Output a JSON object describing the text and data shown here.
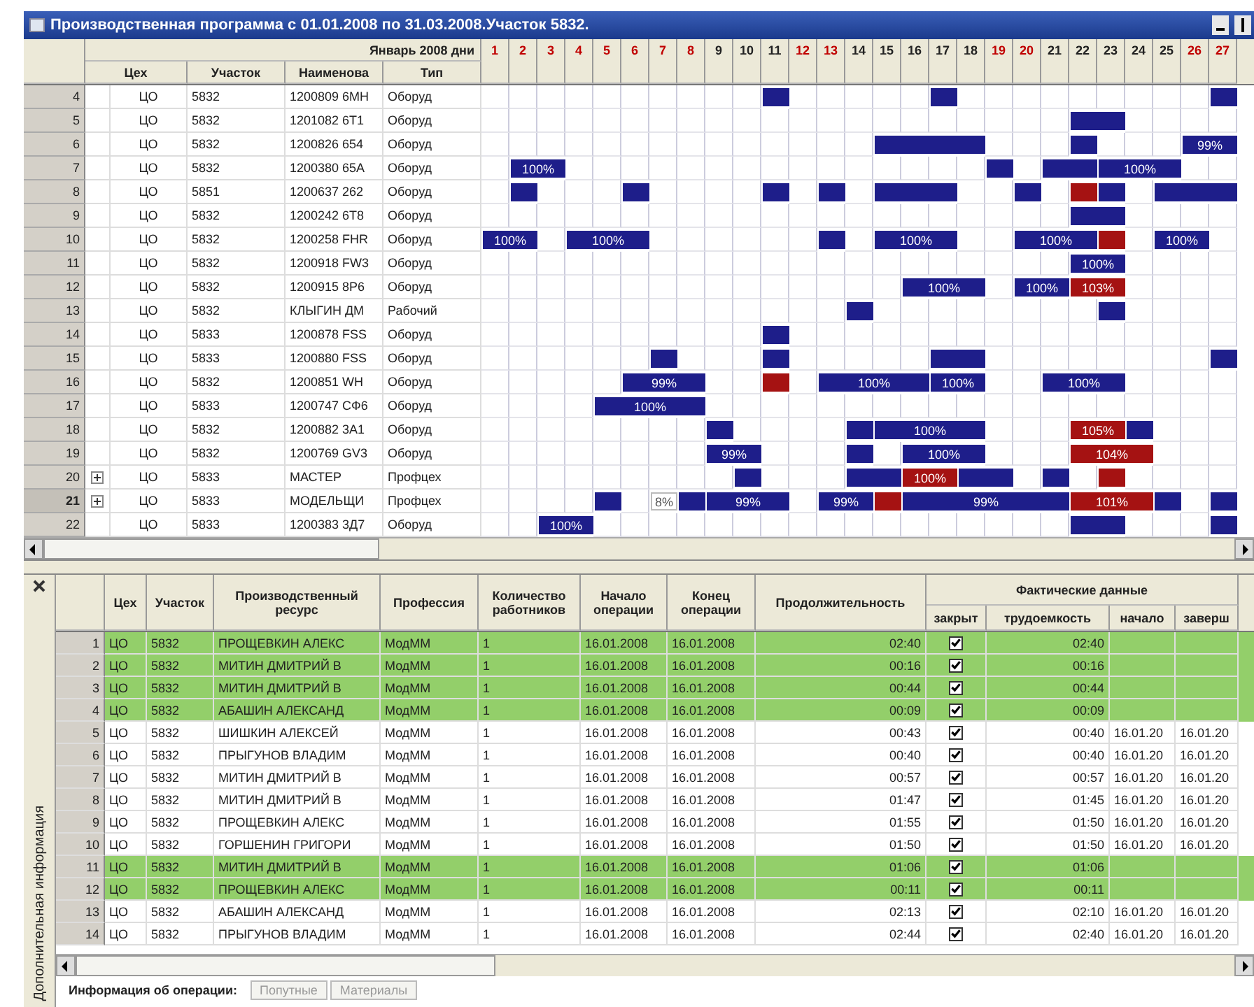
{
  "window": {
    "title": "Производственная программа с 01.01.2008 по 31.03.2008.Участок 5832."
  },
  "plan": {
    "month_label": "Январь 2008  дни",
    "columns": [
      "Цех",
      "Участок",
      "Наименова",
      "Тип"
    ],
    "days": [
      {
        "label": "1",
        "weekend": true
      },
      {
        "label": "2",
        "weekend": true
      },
      {
        "label": "3",
        "weekend": true
      },
      {
        "label": "4",
        "weekend": true
      },
      {
        "label": "5",
        "weekend": true
      },
      {
        "label": "6",
        "weekend": true
      },
      {
        "label": "7",
        "weekend": true
      },
      {
        "label": "8",
        "weekend": true
      },
      {
        "label": "9",
        "weekend": false
      },
      {
        "label": "10",
        "weekend": false
      },
      {
        "label": "11",
        "weekend": false
      },
      {
        "label": "12",
        "weekend": true
      },
      {
        "label": "13",
        "weekend": true
      },
      {
        "label": "14",
        "weekend": false
      },
      {
        "label": "15",
        "weekend": false
      },
      {
        "label": "16",
        "weekend": false
      },
      {
        "label": "17",
        "weekend": false
      },
      {
        "label": "18",
        "weekend": false
      },
      {
        "label": "19",
        "weekend": true
      },
      {
        "label": "20",
        "weekend": true
      },
      {
        "label": "21",
        "weekend": false
      },
      {
        "label": "22",
        "weekend": false
      },
      {
        "label": "23",
        "weekend": false
      },
      {
        "label": "24",
        "weekend": false
      },
      {
        "label": "25",
        "weekend": false
      },
      {
        "label": "26",
        "weekend": true
      },
      {
        "label": "27",
        "weekend": true
      }
    ],
    "rows": [
      {
        "number": "4",
        "selected": false,
        "expandable": false,
        "shop": "ЦО",
        "site": "5832",
        "name": "1200809 6МН",
        "type": "Оборуд",
        "cells": [
          {
            "kind": "none"
          },
          {
            "kind": "none"
          },
          {
            "kind": "none"
          },
          {
            "kind": "none"
          },
          {
            "kind": "none"
          },
          {
            "kind": "none"
          },
          {
            "kind": "none"
          },
          {
            "kind": "none"
          },
          {
            "kind": "none"
          },
          {
            "kind": "none"
          },
          {
            "kind": "plan"
          },
          {
            "kind": "none"
          },
          {
            "kind": "none"
          },
          {
            "kind": "none"
          },
          {
            "kind": "none"
          },
          {
            "kind": "none"
          },
          {
            "kind": "plan"
          },
          {
            "kind": "none"
          },
          {
            "kind": "none"
          },
          {
            "kind": "none"
          },
          {
            "kind": "none"
          },
          {
            "kind": "none"
          },
          {
            "kind": "none"
          },
          {
            "kind": "none"
          },
          {
            "kind": "none"
          },
          {
            "kind": "none"
          },
          {
            "kind": "plan"
          }
        ]
      },
      {
        "number": "5",
        "selected": false,
        "expandable": false,
        "shop": "ЦО",
        "site": "5832",
        "name": "1201082 6Т1",
        "type": "Оборуд",
        "cells": [
          {
            "kind": "none"
          },
          {
            "kind": "none"
          },
          {
            "kind": "none"
          },
          {
            "kind": "none"
          },
          {
            "kind": "none"
          },
          {
            "kind": "none"
          },
          {
            "kind": "none"
          },
          {
            "kind": "none"
          },
          {
            "kind": "none"
          },
          {
            "kind": "none"
          },
          {
            "kind": "none"
          },
          {
            "kind": "none"
          },
          {
            "kind": "none"
          },
          {
            "kind": "none"
          },
          {
            "kind": "none"
          },
          {
            "kind": "none"
          },
          {
            "kind": "none"
          },
          {
            "kind": "none"
          },
          {
            "kind": "none"
          },
          {
            "kind": "none"
          },
          {
            "kind": "none"
          },
          {
            "kind": "plan"
          },
          {
            "kind": "plan"
          },
          {
            "kind": "none"
          },
          {
            "kind": "none"
          },
          {
            "kind": "none"
          },
          {
            "kind": "none"
          }
        ]
      },
      {
        "number": "6",
        "selected": false,
        "expandable": false,
        "shop": "ЦО",
        "site": "5832",
        "name": "1200826 654",
        "type": "Оборуд",
        "cells": [
          {
            "kind": "none"
          },
          {
            "kind": "none"
          },
          {
            "kind": "none"
          },
          {
            "kind": "none"
          },
          {
            "kind": "none"
          },
          {
            "kind": "none"
          },
          {
            "kind": "none"
          },
          {
            "kind": "none"
          },
          {
            "kind": "none"
          },
          {
            "kind": "none"
          },
          {
            "kind": "none"
          },
          {
            "kind": "none"
          },
          {
            "kind": "none"
          },
          {
            "kind": "none"
          },
          {
            "kind": "plan"
          },
          {
            "kind": "plan"
          },
          {
            "kind": "plan"
          },
          {
            "kind": "plan"
          },
          {
            "kind": "none"
          },
          {
            "kind": "none"
          },
          {
            "kind": "none"
          },
          {
            "kind": "plan"
          },
          {
            "kind": "none"
          },
          {
            "kind": "none"
          },
          {
            "kind": "none"
          },
          {
            "kind": "plan",
            "label": "99%"
          },
          {
            "kind": "plan"
          }
        ]
      },
      {
        "number": "7",
        "selected": false,
        "expandable": false,
        "shop": "ЦО",
        "site": "5832",
        "name": "1200380 65А",
        "type": "Оборуд",
        "cells": [
          {
            "kind": "none"
          },
          {
            "kind": "plan",
            "label": "100%"
          },
          {
            "kind": "plan"
          },
          {
            "kind": "none"
          },
          {
            "kind": "none"
          },
          {
            "kind": "none"
          },
          {
            "kind": "none"
          },
          {
            "kind": "none"
          },
          {
            "kind": "none"
          },
          {
            "kind": "none"
          },
          {
            "kind": "none"
          },
          {
            "kind": "none"
          },
          {
            "kind": "none"
          },
          {
            "kind": "none"
          },
          {
            "kind": "none"
          },
          {
            "kind": "none"
          },
          {
            "kind": "none"
          },
          {
            "kind": "none"
          },
          {
            "kind": "plan"
          },
          {
            "kind": "none"
          },
          {
            "kind": "plan"
          },
          {
            "kind": "plan"
          },
          {
            "kind": "plan",
            "label": "100%"
          },
          {
            "kind": "plan"
          },
          {
            "kind": "plan"
          },
          {
            "kind": "none"
          },
          {
            "kind": "none"
          }
        ]
      },
      {
        "number": "8",
        "selected": false,
        "expandable": false,
        "shop": "ЦО",
        "site": "5851",
        "name": "1200637 262",
        "type": "Оборуд",
        "cells": [
          {
            "kind": "none"
          },
          {
            "kind": "plan"
          },
          {
            "kind": "none"
          },
          {
            "kind": "none"
          },
          {
            "kind": "none"
          },
          {
            "kind": "plan"
          },
          {
            "kind": "none"
          },
          {
            "kind": "none"
          },
          {
            "kind": "none"
          },
          {
            "kind": "none"
          },
          {
            "kind": "plan"
          },
          {
            "kind": "none"
          },
          {
            "kind": "plan"
          },
          {
            "kind": "none"
          },
          {
            "kind": "plan"
          },
          {
            "kind": "plan"
          },
          {
            "kind": "plan"
          },
          {
            "kind": "none"
          },
          {
            "kind": "none"
          },
          {
            "kind": "plan"
          },
          {
            "kind": "none"
          },
          {
            "kind": "over"
          },
          {
            "kind": "plan"
          },
          {
            "kind": "none"
          },
          {
            "kind": "plan"
          },
          {
            "kind": "plan"
          },
          {
            "kind": "plan"
          }
        ]
      },
      {
        "number": "9",
        "selected": false,
        "expandable": false,
        "shop": "ЦО",
        "site": "5832",
        "name": "1200242 6Т8",
        "type": "Оборуд",
        "cells": [
          {
            "kind": "none"
          },
          {
            "kind": "none"
          },
          {
            "kind": "none"
          },
          {
            "kind": "none"
          },
          {
            "kind": "none"
          },
          {
            "kind": "none"
          },
          {
            "kind": "none"
          },
          {
            "kind": "none"
          },
          {
            "kind": "none"
          },
          {
            "kind": "none"
          },
          {
            "kind": "none"
          },
          {
            "kind": "none"
          },
          {
            "kind": "none"
          },
          {
            "kind": "none"
          },
          {
            "kind": "none"
          },
          {
            "kind": "none"
          },
          {
            "kind": "none"
          },
          {
            "kind": "none"
          },
          {
            "kind": "none"
          },
          {
            "kind": "none"
          },
          {
            "kind": "none"
          },
          {
            "kind": "plan"
          },
          {
            "kind": "plan"
          },
          {
            "kind": "none"
          },
          {
            "kind": "none"
          },
          {
            "kind": "none"
          },
          {
            "kind": "none"
          }
        ]
      },
      {
        "number": "10",
        "selected": false,
        "expandable": false,
        "shop": "ЦО",
        "site": "5832",
        "name": "1200258 FHR",
        "type": "Оборуд",
        "cells": [
          {
            "kind": "plan",
            "label": "100%"
          },
          {
            "kind": "plan"
          },
          {
            "kind": "none"
          },
          {
            "kind": "plan",
            "label": "100%"
          },
          {
            "kind": "plan"
          },
          {
            "kind": "plan"
          },
          {
            "kind": "none"
          },
          {
            "kind": "none"
          },
          {
            "kind": "none"
          },
          {
            "kind": "none"
          },
          {
            "kind": "none"
          },
          {
            "kind": "none"
          },
          {
            "kind": "plan"
          },
          {
            "kind": "none"
          },
          {
            "kind": "plan",
            "label": "100%"
          },
          {
            "kind": "plan"
          },
          {
            "kind": "plan"
          },
          {
            "kind": "none"
          },
          {
            "kind": "none"
          },
          {
            "kind": "plan",
            "label": "100%"
          },
          {
            "kind": "plan"
          },
          {
            "kind": "plan"
          },
          {
            "kind": "over"
          },
          {
            "kind": "none"
          },
          {
            "kind": "plan",
            "label": "100%"
          },
          {
            "kind": "plan"
          },
          {
            "kind": "none"
          }
        ]
      },
      {
        "number": "11",
        "selected": false,
        "expandable": false,
        "shop": "ЦО",
        "site": "5832",
        "name": "1200918 FW3",
        "type": "Оборуд",
        "cells": [
          {
            "kind": "none"
          },
          {
            "kind": "none"
          },
          {
            "kind": "none"
          },
          {
            "kind": "none"
          },
          {
            "kind": "none"
          },
          {
            "kind": "none"
          },
          {
            "kind": "none"
          },
          {
            "kind": "none"
          },
          {
            "kind": "none"
          },
          {
            "kind": "none"
          },
          {
            "kind": "none"
          },
          {
            "kind": "none"
          },
          {
            "kind": "none"
          },
          {
            "kind": "none"
          },
          {
            "kind": "none"
          },
          {
            "kind": "none"
          },
          {
            "kind": "none"
          },
          {
            "kind": "none"
          },
          {
            "kind": "none"
          },
          {
            "kind": "none"
          },
          {
            "kind": "none"
          },
          {
            "kind": "plan",
            "label": "100%"
          },
          {
            "kind": "plan"
          },
          {
            "kind": "none"
          },
          {
            "kind": "none"
          },
          {
            "kind": "none"
          },
          {
            "kind": "none"
          }
        ]
      },
      {
        "number": "12",
        "selected": false,
        "expandable": false,
        "shop": "ЦО",
        "site": "5832",
        "name": "1200915 8Р6",
        "type": "Оборуд",
        "cells": [
          {
            "kind": "none"
          },
          {
            "kind": "none"
          },
          {
            "kind": "none"
          },
          {
            "kind": "none"
          },
          {
            "kind": "none"
          },
          {
            "kind": "none"
          },
          {
            "kind": "none"
          },
          {
            "kind": "none"
          },
          {
            "kind": "none"
          },
          {
            "kind": "none"
          },
          {
            "kind": "none"
          },
          {
            "kind": "none"
          },
          {
            "kind": "none"
          },
          {
            "kind": "none"
          },
          {
            "kind": "none"
          },
          {
            "kind": "plan",
            "label": "100%"
          },
          {
            "kind": "plan"
          },
          {
            "kind": "plan"
          },
          {
            "kind": "none"
          },
          {
            "kind": "plan",
            "label": "100%"
          },
          {
            "kind": "plan"
          },
          {
            "kind": "over",
            "label": "103%"
          },
          {
            "kind": "over"
          },
          {
            "kind": "none"
          },
          {
            "kind": "none"
          },
          {
            "kind": "none"
          },
          {
            "kind": "none"
          }
        ]
      },
      {
        "number": "13",
        "selected": false,
        "expandable": false,
        "shop": "ЦО",
        "site": "5832",
        "name": "КЛЫГИН ДМ",
        "type": "Рабочий",
        "cells": [
          {
            "kind": "none"
          },
          {
            "kind": "none"
          },
          {
            "kind": "none"
          },
          {
            "kind": "none"
          },
          {
            "kind": "none"
          },
          {
            "kind": "none"
          },
          {
            "kind": "none"
          },
          {
            "kind": "none"
          },
          {
            "kind": "none"
          },
          {
            "kind": "none"
          },
          {
            "kind": "none"
          },
          {
            "kind": "none"
          },
          {
            "kind": "none"
          },
          {
            "kind": "plan"
          },
          {
            "kind": "none"
          },
          {
            "kind": "none"
          },
          {
            "kind": "none"
          },
          {
            "kind": "none"
          },
          {
            "kind": "none"
          },
          {
            "kind": "none"
          },
          {
            "kind": "none"
          },
          {
            "kind": "none"
          },
          {
            "kind": "plan"
          },
          {
            "kind": "none"
          },
          {
            "kind": "none"
          },
          {
            "kind": "none"
          },
          {
            "kind": "none"
          }
        ]
      },
      {
        "number": "14",
        "selected": false,
        "expandable": false,
        "shop": "ЦО",
        "site": "5833",
        "name": "1200878 FSS",
        "type": "Оборуд",
        "cells": [
          {
            "kind": "none"
          },
          {
            "kind": "none"
          },
          {
            "kind": "none"
          },
          {
            "kind": "none"
          },
          {
            "kind": "none"
          },
          {
            "kind": "none"
          },
          {
            "kind": "none"
          },
          {
            "kind": "none"
          },
          {
            "kind": "none"
          },
          {
            "kind": "none"
          },
          {
            "kind": "plan"
          },
          {
            "kind": "none"
          },
          {
            "kind": "none"
          },
          {
            "kind": "none"
          },
          {
            "kind": "none"
          },
          {
            "kind": "none"
          },
          {
            "kind": "none"
          },
          {
            "kind": "none"
          },
          {
            "kind": "none"
          },
          {
            "kind": "none"
          },
          {
            "kind": "none"
          },
          {
            "kind": "none"
          },
          {
            "kind": "none"
          },
          {
            "kind": "none"
          },
          {
            "kind": "none"
          },
          {
            "kind": "none"
          },
          {
            "kind": "none"
          }
        ]
      },
      {
        "number": "15",
        "selected": false,
        "expandable": false,
        "shop": "ЦО",
        "site": "5833",
        "name": "1200880 FSS",
        "type": "Оборуд",
        "cells": [
          {
            "kind": "none"
          },
          {
            "kind": "none"
          },
          {
            "kind": "none"
          },
          {
            "kind": "none"
          },
          {
            "kind": "none"
          },
          {
            "kind": "none"
          },
          {
            "kind": "plan"
          },
          {
            "kind": "none"
          },
          {
            "kind": "none"
          },
          {
            "kind": "none"
          },
          {
            "kind": "plan"
          },
          {
            "kind": "none"
          },
          {
            "kind": "none"
          },
          {
            "kind": "none"
          },
          {
            "kind": "none"
          },
          {
            "kind": "none"
          },
          {
            "kind": "plan"
          },
          {
            "kind": "plan"
          },
          {
            "kind": "none"
          },
          {
            "kind": "none"
          },
          {
            "kind": "none"
          },
          {
            "kind": "none"
          },
          {
            "kind": "none"
          },
          {
            "kind": "none"
          },
          {
            "kind": "none"
          },
          {
            "kind": "none"
          },
          {
            "kind": "plan"
          }
        ]
      },
      {
        "number": "16",
        "selected": false,
        "expandable": false,
        "shop": "ЦО",
        "site": "5832",
        "name": "1200851 WH",
        "type": "Оборуд",
        "cells": [
          {
            "kind": "none"
          },
          {
            "kind": "none"
          },
          {
            "kind": "none"
          },
          {
            "kind": "none"
          },
          {
            "kind": "none"
          },
          {
            "kind": "plan",
            "label": "99%"
          },
          {
            "kind": "plan"
          },
          {
            "kind": "plan"
          },
          {
            "kind": "none"
          },
          {
            "kind": "none"
          },
          {
            "kind": "over"
          },
          {
            "kind": "none"
          },
          {
            "kind": "plan",
            "label": "100%"
          },
          {
            "kind": "plan"
          },
          {
            "kind": "plan"
          },
          {
            "kind": "plan"
          },
          {
            "kind": "plan",
            "label": "100%"
          },
          {
            "kind": "plan"
          },
          {
            "kind": "none"
          },
          {
            "kind": "none"
          },
          {
            "kind": "plan",
            "label": "100%"
          },
          {
            "kind": "plan"
          },
          {
            "kind": "plan"
          },
          {
            "kind": "none"
          },
          {
            "kind": "none"
          },
          {
            "kind": "none"
          },
          {
            "kind": "none"
          }
        ]
      },
      {
        "number": "17",
        "selected": false,
        "expandable": false,
        "shop": "ЦО",
        "site": "5833",
        "name": "1200747 СФ6",
        "type": "Оборуд",
        "cells": [
          {
            "kind": "none"
          },
          {
            "kind": "none"
          },
          {
            "kind": "none"
          },
          {
            "kind": "none"
          },
          {
            "kind": "plan",
            "label": "100%"
          },
          {
            "kind": "plan"
          },
          {
            "kind": "plan"
          },
          {
            "kind": "plan"
          },
          {
            "kind": "none"
          },
          {
            "kind": "none"
          },
          {
            "kind": "none"
          },
          {
            "kind": "none"
          },
          {
            "kind": "none"
          },
          {
            "kind": "none"
          },
          {
            "kind": "none"
          },
          {
            "kind": "none"
          },
          {
            "kind": "none"
          },
          {
            "kind": "none"
          },
          {
            "kind": "none"
          },
          {
            "kind": "none"
          },
          {
            "kind": "none"
          },
          {
            "kind": "none"
          },
          {
            "kind": "none"
          },
          {
            "kind": "none"
          },
          {
            "kind": "none"
          },
          {
            "kind": "none"
          },
          {
            "kind": "none"
          }
        ]
      },
      {
        "number": "18",
        "selected": false,
        "expandable": false,
        "shop": "ЦО",
        "site": "5832",
        "name": "1200882 3А1",
        "type": "Оборуд",
        "cells": [
          {
            "kind": "none"
          },
          {
            "kind": "none"
          },
          {
            "kind": "none"
          },
          {
            "kind": "none"
          },
          {
            "kind": "none"
          },
          {
            "kind": "none"
          },
          {
            "kind": "none"
          },
          {
            "kind": "none"
          },
          {
            "kind": "plan"
          },
          {
            "kind": "none"
          },
          {
            "kind": "none"
          },
          {
            "kind": "none"
          },
          {
            "kind": "none"
          },
          {
            "kind": "plan"
          },
          {
            "kind": "plan",
            "label": "100%"
          },
          {
            "kind": "plan"
          },
          {
            "kind": "plan"
          },
          {
            "kind": "plan"
          },
          {
            "kind": "none"
          },
          {
            "kind": "none"
          },
          {
            "kind": "none"
          },
          {
            "kind": "over",
            "label": "105%"
          },
          {
            "kind": "over"
          },
          {
            "kind": "plan"
          },
          {
            "kind": "none"
          },
          {
            "kind": "none"
          },
          {
            "kind": "none"
          }
        ]
      },
      {
        "number": "19",
        "selected": false,
        "expandable": false,
        "shop": "ЦО",
        "site": "5832",
        "name": "1200769 GV3",
        "type": "Оборуд",
        "cells": [
          {
            "kind": "none"
          },
          {
            "kind": "none"
          },
          {
            "kind": "none"
          },
          {
            "kind": "none"
          },
          {
            "kind": "none"
          },
          {
            "kind": "none"
          },
          {
            "kind": "none"
          },
          {
            "kind": "none"
          },
          {
            "kind": "plan",
            "label": "99%"
          },
          {
            "kind": "plan"
          },
          {
            "kind": "none"
          },
          {
            "kind": "none"
          },
          {
            "kind": "none"
          },
          {
            "kind": "plan"
          },
          {
            "kind": "none"
          },
          {
            "kind": "plan",
            "label": "100%"
          },
          {
            "kind": "plan"
          },
          {
            "kind": "plan"
          },
          {
            "kind": "none"
          },
          {
            "kind": "none"
          },
          {
            "kind": "none"
          },
          {
            "kind": "over",
            "label": "104%"
          },
          {
            "kind": "over"
          },
          {
            "kind": "over"
          },
          {
            "kind": "none"
          },
          {
            "kind": "none"
          },
          {
            "kind": "none"
          }
        ]
      },
      {
        "number": "20",
        "selected": false,
        "expandable": true,
        "shop": "ЦО",
        "site": "5833",
        "name": "МАСТЕР",
        "type": "Профцех",
        "cells": [
          {
            "kind": "none"
          },
          {
            "kind": "none"
          },
          {
            "kind": "none"
          },
          {
            "kind": "none"
          },
          {
            "kind": "none"
          },
          {
            "kind": "none"
          },
          {
            "kind": "none"
          },
          {
            "kind": "none"
          },
          {
            "kind": "none"
          },
          {
            "kind": "plan"
          },
          {
            "kind": "none"
          },
          {
            "kind": "none"
          },
          {
            "kind": "none"
          },
          {
            "kind": "plan"
          },
          {
            "kind": "plan"
          },
          {
            "kind": "over",
            "label": "100%"
          },
          {
            "kind": "over"
          },
          {
            "kind": "plan"
          },
          {
            "kind": "plan"
          },
          {
            "kind": "none"
          },
          {
            "kind": "plan"
          },
          {
            "kind": "none"
          },
          {
            "kind": "over"
          },
          {
            "kind": "none"
          },
          {
            "kind": "none"
          },
          {
            "kind": "none"
          },
          {
            "kind": "none"
          }
        ]
      },
      {
        "number": "21",
        "selected": true,
        "expandable": true,
        "shop": "ЦО",
        "site": "5833",
        "name": "МОДЕЛЬЩИ",
        "type": "Профцех",
        "cells": [
          {
            "kind": "none"
          },
          {
            "kind": "none"
          },
          {
            "kind": "none"
          },
          {
            "kind": "none"
          },
          {
            "kind": "plan"
          },
          {
            "kind": "none"
          },
          {
            "kind": "note",
            "label": "8%"
          },
          {
            "kind": "plan"
          },
          {
            "kind": "plan",
            "label": "99%"
          },
          {
            "kind": "plan"
          },
          {
            "kind": "plan"
          },
          {
            "kind": "none"
          },
          {
            "kind": "plan",
            "label": "99%"
          },
          {
            "kind": "plan"
          },
          {
            "kind": "over"
          },
          {
            "kind": "plan",
            "label": "99%"
          },
          {
            "kind": "plan"
          },
          {
            "kind": "plan"
          },
          {
            "kind": "plan"
          },
          {
            "kind": "plan"
          },
          {
            "kind": "plan"
          },
          {
            "kind": "over",
            "label": "101%"
          },
          {
            "kind": "over"
          },
          {
            "kind": "over"
          },
          {
            "kind": "plan"
          },
          {
            "kind": "none"
          },
          {
            "kind": "plan"
          }
        ]
      },
      {
        "number": "22",
        "selected": false,
        "expandable": false,
        "shop": "ЦО",
        "site": "5833",
        "name": "1200383 3Д7",
        "type": "Оборуд",
        "cells": [
          {
            "kind": "none"
          },
          {
            "kind": "none"
          },
          {
            "kind": "plan",
            "label": "100%"
          },
          {
            "kind": "plan"
          },
          {
            "kind": "none"
          },
          {
            "kind": "none"
          },
          {
            "kind": "none"
          },
          {
            "kind": "none"
          },
          {
            "kind": "none"
          },
          {
            "kind": "none"
          },
          {
            "kind": "none"
          },
          {
            "kind": "none"
          },
          {
            "kind": "none"
          },
          {
            "kind": "none"
          },
          {
            "kind": "none"
          },
          {
            "kind": "none"
          },
          {
            "kind": "none"
          },
          {
            "kind": "none"
          },
          {
            "kind": "none"
          },
          {
            "kind": "none"
          },
          {
            "kind": "none"
          },
          {
            "kind": "plan"
          },
          {
            "kind": "plan"
          },
          {
            "kind": "none"
          },
          {
            "kind": "none"
          },
          {
            "kind": "none"
          },
          {
            "kind": "plan"
          }
        ]
      }
    ]
  },
  "details": {
    "side_label": "Дополнительная информация",
    "columns": [
      "Цех",
      "Участок",
      "Производственный ресурс",
      "Профессия",
      "Количество работников",
      "Начало операции",
      "Конец операции",
      "Продолжительность"
    ],
    "group_label": "Фактические данные",
    "group_columns": [
      "закрыт",
      "трудоемкость",
      "начало",
      "заверш"
    ],
    "rows": [
      {
        "number": "1",
        "highlighted": true,
        "shop": "ЦО",
        "site": "5832",
        "resource": "ПРОЩЕВКИН АЛЕКС",
        "profession": "МодММ",
        "workers": "1",
        "start": "16.01.2008",
        "end": "16.01.2008",
        "duration": "02:40",
        "closed": true,
        "labor": "02:40"
      },
      {
        "number": "2",
        "highlighted": true,
        "shop": "ЦО",
        "site": "5832",
        "resource": "МИТИН ДМИТРИЙ В",
        "profession": "МодММ",
        "workers": "1",
        "start": "16.01.2008",
        "end": "16.01.2008",
        "duration": "00:16",
        "closed": true,
        "labor": "00:16"
      },
      {
        "number": "3",
        "highlighted": true,
        "shop": "ЦО",
        "site": "5832",
        "resource": "МИТИН ДМИТРИЙ В",
        "profession": "МодММ",
        "workers": "1",
        "start": "16.01.2008",
        "end": "16.01.2008",
        "duration": "00:44",
        "closed": true,
        "labor": "00:44"
      },
      {
        "number": "4",
        "highlighted": true,
        "shop": "ЦО",
        "site": "5832",
        "resource": "АБАШИН АЛЕКСАНД",
        "profession": "МодММ",
        "workers": "1",
        "start": "16.01.2008",
        "end": "16.01.2008",
        "duration": "00:09",
        "closed": true,
        "labor": "00:09"
      },
      {
        "number": "5",
        "highlighted": false,
        "shop": "ЦО",
        "site": "5832",
        "resource": "ШИШКИН АЛЕКСЕЙ",
        "profession": "МодММ",
        "workers": "1",
        "start": "16.01.2008",
        "end": "16.01.2008",
        "duration": "00:43",
        "closed": true,
        "labor": "00:40",
        "fact_start": "16.01.20",
        "fact_end": "16.01.20"
      },
      {
        "number": "6",
        "highlighted": false,
        "shop": "ЦО",
        "site": "5832",
        "resource": "ПРЫГУНОВ ВЛАДИМ",
        "profession": "МодММ",
        "workers": "1",
        "start": "16.01.2008",
        "end": "16.01.2008",
        "duration": "00:40",
        "closed": true,
        "labor": "00:40",
        "fact_start": "16.01.20",
        "fact_end": "16.01.20"
      },
      {
        "number": "7",
        "highlighted": false,
        "shop": "ЦО",
        "site": "5832",
        "resource": "МИТИН ДМИТРИЙ В",
        "profession": "МодММ",
        "workers": "1",
        "start": "16.01.2008",
        "end": "16.01.2008",
        "duration": "00:57",
        "closed": true,
        "labor": "00:57",
        "fact_start": "16.01.20",
        "fact_end": "16.01.20"
      },
      {
        "number": "8",
        "highlighted": false,
        "shop": "ЦО",
        "site": "5832",
        "resource": "МИТИН ДМИТРИЙ В",
        "profession": "МодММ",
        "workers": "1",
        "start": "16.01.2008",
        "end": "16.01.2008",
        "duration": "01:47",
        "closed": true,
        "labor": "01:45",
        "fact_start": "16.01.20",
        "fact_end": "16.01.20"
      },
      {
        "number": "9",
        "highlighted": false,
        "shop": "ЦО",
        "site": "5832",
        "resource": "ПРОЩЕВКИН АЛЕКС",
        "profession": "МодММ",
        "workers": "1",
        "start": "16.01.2008",
        "end": "16.01.2008",
        "duration": "01:55",
        "closed": true,
        "labor": "01:50",
        "fact_start": "16.01.20",
        "fact_end": "16.01.20"
      },
      {
        "number": "10",
        "highlighted": false,
        "shop": "ЦО",
        "site": "5832",
        "resource": "ГОРШЕНИН ГРИГОРИ",
        "profession": "МодММ",
        "workers": "1",
        "start": "16.01.2008",
        "end": "16.01.2008",
        "duration": "01:50",
        "closed": true,
        "labor": "01:50",
        "fact_start": "16.01.20",
        "fact_end": "16.01.20"
      },
      {
        "number": "11",
        "highlighted": true,
        "shop": "ЦО",
        "site": "5832",
        "resource": "МИТИН ДМИТРИЙ В",
        "profession": "МодММ",
        "workers": "1",
        "start": "16.01.2008",
        "end": "16.01.2008",
        "duration": "01:06",
        "closed": true,
        "labor": "01:06"
      },
      {
        "number": "12",
        "highlighted": true,
        "shop": "ЦО",
        "site": "5832",
        "resource": "ПРОЩЕВКИН АЛЕКС",
        "profession": "МодММ",
        "workers": "1",
        "start": "16.01.2008",
        "end": "16.01.2008",
        "duration": "00:11",
        "closed": true,
        "labor": "00:11"
      },
      {
        "number": "13",
        "highlighted": false,
        "shop": "ЦО",
        "site": "5832",
        "resource": "АБАШИН АЛЕКСАНД",
        "profession": "МодММ",
        "workers": "1",
        "start": "16.01.2008",
        "end": "16.01.2008",
        "duration": "02:13",
        "closed": true,
        "labor": "02:10",
        "fact_start": "16.01.20",
        "fact_end": "16.01.20"
      },
      {
        "number": "14",
        "highlighted": false,
        "shop": "ЦО",
        "site": "5832",
        "resource": "ПРЫГУНОВ ВЛАДИМ",
        "profession": "МодММ",
        "workers": "1",
        "start": "16.01.2008",
        "end": "16.01.2008",
        "duration": "02:44",
        "closed": true,
        "labor": "02:40",
        "fact_start": "16.01.20",
        "fact_end": "16.01.20"
      }
    ],
    "tabs": [
      {
        "label": "Информация об операции:",
        "selected": true
      },
      {
        "label": "Попутные",
        "selected": false
      },
      {
        "label": "Материалы",
        "selected": false
      }
    ]
  }
}
